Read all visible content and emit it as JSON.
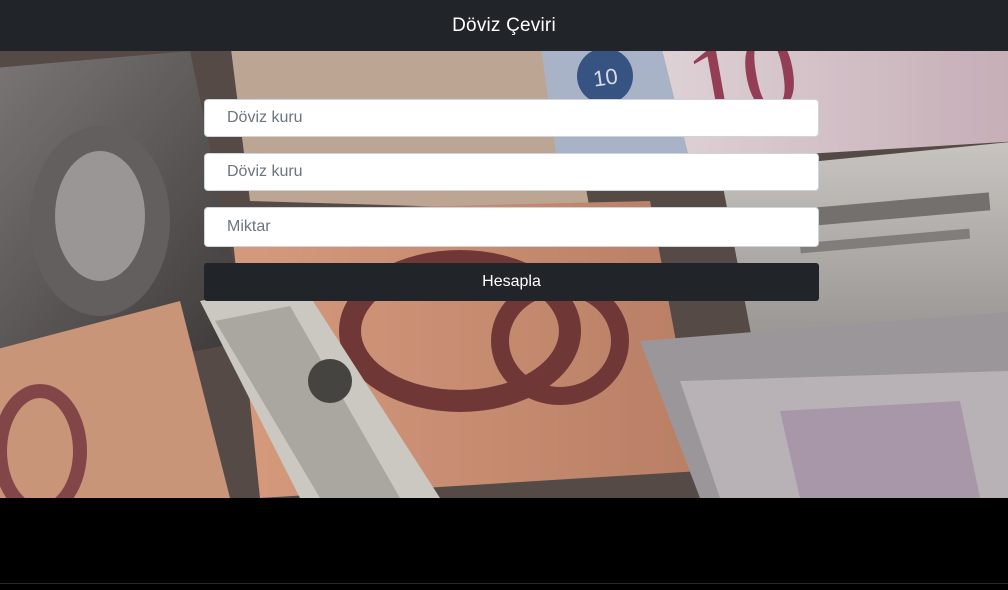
{
  "header": {
    "title": "Döviz Çeviri"
  },
  "form": {
    "from_currency": {
      "placeholder": "Döviz kuru",
      "value": ""
    },
    "to_currency": {
      "placeholder": "Döviz kuru",
      "value": ""
    },
    "amount": {
      "placeholder": "Miktar",
      "value": ""
    },
    "submit_label": "Hesapla"
  },
  "colors": {
    "navbar": "#212529",
    "button": "#212529",
    "page_background": "#000000"
  }
}
